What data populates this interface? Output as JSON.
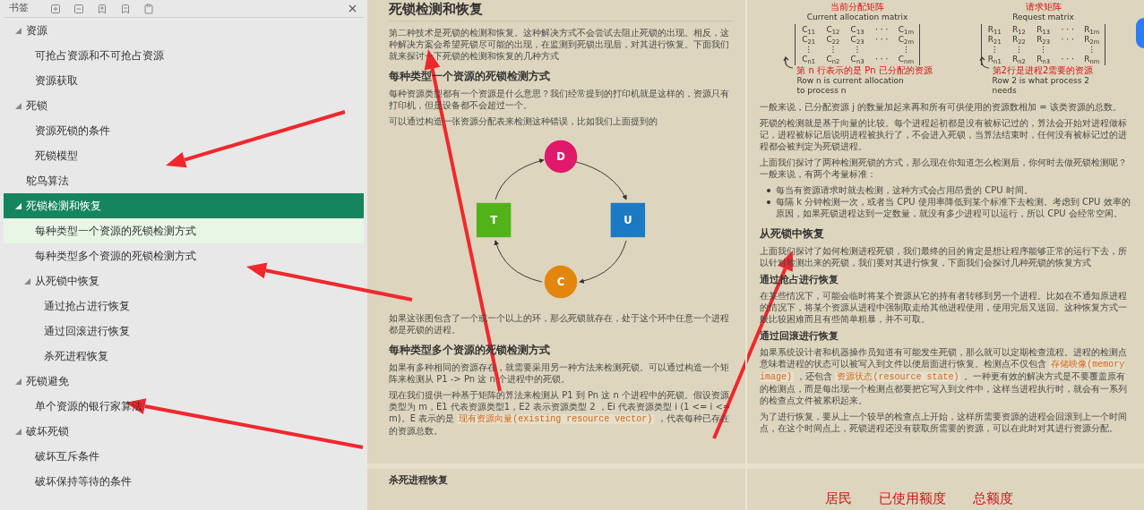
{
  "sidebar": {
    "title": "书签",
    "items": [
      {
        "label": "资源",
        "expanded": true,
        "selected": false,
        "highlighted": false,
        "children": [
          {
            "label": "可抢占资源和不可抢占资源",
            "selected": false,
            "highlighted": false
          },
          {
            "label": "资源获取",
            "selected": false,
            "highlighted": false
          }
        ]
      },
      {
        "label": "死锁",
        "expanded": true,
        "selected": false,
        "highlighted": false,
        "children": [
          {
            "label": "资源死锁的条件",
            "selected": false,
            "highlighted": false
          },
          {
            "label": "死锁模型",
            "selected": false,
            "highlighted": false
          }
        ]
      },
      {
        "label": "鸵鸟算法",
        "selected": false,
        "highlighted": false
      },
      {
        "label": "死锁检测和恢复",
        "expanded": true,
        "selected": true,
        "highlighted": false,
        "children": [
          {
            "label": "每种类型一个资源的死锁检测方式",
            "selected": false,
            "highlighted": true
          },
          {
            "label": "每种类型多个资源的死锁检测方式",
            "selected": false,
            "highlighted": false
          },
          {
            "label": "从死锁中恢复",
            "expanded": true,
            "selected": false,
            "highlighted": false,
            "children": [
              {
                "label": "通过抢占进行恢复",
                "selected": false,
                "highlighted": false
              },
              {
                "label": "通过回滚进行恢复",
                "selected": false,
                "highlighted": false
              },
              {
                "label": "杀死进程恢复",
                "selected": false,
                "highlighted": false
              }
            ]
          }
        ]
      },
      {
        "label": "死锁避免",
        "expanded": true,
        "selected": false,
        "highlighted": false,
        "children": [
          {
            "label": "单个资源的银行家算法",
            "selected": false,
            "highlighted": false
          }
        ]
      },
      {
        "label": "破坏死锁",
        "expanded": true,
        "selected": false,
        "highlighted": false,
        "children": [
          {
            "label": "破坏互斥条件",
            "selected": false,
            "highlighted": false
          },
          {
            "label": "破坏保持等待的条件",
            "selected": false,
            "highlighted": false
          }
        ]
      }
    ]
  },
  "columns": [
    {
      "pages": [
        {
          "blocks": [
            {
              "kind": "title",
              "text": "死锁检测和恢复"
            },
            {
              "kind": "paragraph",
              "text": "第二种技术是死锁的检测和恢复。这种解决方式不会尝试去阻止死锁的出现。相反，这种解决方案会希望死锁尽可能的出现，在监测到死锁出现后，对其进行恢复。下面我们就来探讨一下死锁的检测和恢复的几种方式"
            },
            {
              "kind": "heading",
              "text": "每种类型一个资源的死锁检测方式"
            },
            {
              "kind": "paragraph",
              "text": "每种资源类型都有一个资源是什么意思？我们经常提到的打印机就是这样的，资源只有打印机，但是设备都不会超过一个。"
            },
            {
              "kind": "paragraph",
              "text": "可以通过构造一张资源分配表来检测这种错误，比如我们上面提到的"
            },
            {
              "kind": "graph",
              "nodes": [
                {
                  "label": "D",
                  "kind": "circle",
                  "color": "#e0196a"
                },
                {
                  "label": "U",
                  "kind": "square",
                  "color": "#1c7ac4"
                },
                {
                  "label": "C",
                  "kind": "circle",
                  "color": "#e2860c"
                },
                {
                  "label": "T",
                  "kind": "square",
                  "color": "#52b21a"
                }
              ]
            },
            {
              "kind": "paragraph",
              "text": "如果这张图包含了一个或一个以上的环，那么死锁就存在，处于这个环中任意一个进程都是死锁的进程。"
            },
            {
              "kind": "heading",
              "text": "每种类型多个资源的死锁检测方式"
            },
            {
              "kind": "paragraph",
              "text": "如果有多种相同的资源存在，就需要采用另一种方法来检测死锁。可以通过构造一个矩阵来检测从 P1 -> Pn 这 n 个进程中的死锁。"
            },
            {
              "kind": "rich_paragraph",
              "parts": [
                {
                  "kind": "text",
                  "text": "现在我们提供一种基于矩阵的算法来检测从 P1 到 Pn 这 n 个进程中的死锁。假设资源类型为 m，E1 代表资源类型1，E2 表示资源类型 2 ，Ei 代表资源类型 i (1 <= i <= m)。E 表示的是 "
                },
                {
                  "kind": "code",
                  "text": "现有资源向量(existing resource vector)"
                },
                {
                  "kind": "text",
                  "text": " ，代表每种已存在的资源总数。"
                }
              ]
            }
          ]
        },
        {
          "blocks": [
            {
              "kind": "subheading",
              "text": "杀死进程恢复"
            }
          ]
        }
      ]
    },
    {
      "pages": [
        {
          "blocks": [
            {
              "kind": "matrices",
              "items": [
                {
                  "caption_cn": "当前分配矩阵",
                  "caption_en": "Current allocation matrix",
                  "rows": [
                    [
                      "C$_{11}$",
                      "C$_{12}$",
                      "C$_{13}$",
                      "· · ·",
                      "C$_{1m}$"
                    ],
                    [
                      "C$_{21}$",
                      "C$_{22}$",
                      "C$_{23}$",
                      "· · ·",
                      "C$_{2m}$"
                    ],
                    [
                      "⋮",
                      "⋮",
                      "⋮",
                      "",
                      "⋮"
                    ],
                    [
                      "C$_{n1}$",
                      "C$_{n2}$",
                      "C$_{n3}$",
                      "· · ·",
                      "C$_{nm}$"
                    ]
                  ],
                  "note_cn": "第 n 行表示的是 Pn 已分配的资源",
                  "note_en": "Row n is current allocation to process n"
                },
                {
                  "caption_cn": "请求矩阵",
                  "caption_en": "Request matrix",
                  "rows": [
                    [
                      "R$_{11}$",
                      "R$_{12}$",
                      "R$_{13}$",
                      "· · ·",
                      "R$_{1m}$"
                    ],
                    [
                      "R$_{21}$",
                      "R$_{22}$",
                      "R$_{23}$",
                      "· · ·",
                      "R$_{2m}$"
                    ],
                    [
                      "⋮",
                      "⋮",
                      "⋮",
                      "",
                      "⋮"
                    ],
                    [
                      "R$_{n1}$",
                      "R$_{n2}$",
                      "R$_{n3}$",
                      "· · ·",
                      "R$_{nm}$"
                    ]
                  ],
                  "note_cn": "第2行是进程2需要的资源",
                  "note_en": "Row 2 is what process 2 needs"
                }
              ]
            },
            {
              "kind": "paragraph",
              "text": "一般来说，已分配资源 j 的数量加起来再和所有可供使用的资源数相加 = 该类资源的总数。"
            },
            {
              "kind": "paragraph",
              "text": "死锁的检测就是基于向量的比较。每个进程起初都是没有被标记过的，算法会开始对进程做标记，进程被标记后说明进程被执行了，不会进入死锁，当算法结束时，任何没有被标记过的进程都会被判定为死锁进程。"
            },
            {
              "kind": "paragraph",
              "text": "上面我们探讨了两种检测死锁的方式，那么现在你知道怎么检测后，你何时去做死锁检测呢？一般来说，有两个考量标准："
            },
            {
              "kind": "bullets",
              "items": [
                "每当有资源请求时就去检测，这种方式会占用昂贵的 CPU 时间。",
                "每隔 k 分钟检测一次，或者当 CPU 使用率降低到某个标准下去检测。考虑到 CPU 效率的原因，如果死锁进程达到一定数量，就没有多少进程可以运行，所以 CPU 会经常空闲。"
              ]
            },
            {
              "kind": "heading",
              "text": "从死锁中恢复"
            },
            {
              "kind": "paragraph",
              "text": "上面我们探讨了如何检测进程死锁，我们最终的目的肯定是想让程序能够正常的运行下去，所以针对检测出来的死锁，我们要对其进行恢复，下面我们会探讨几种死锁的恢复方式"
            },
            {
              "kind": "subheading",
              "text": "通过抢占进行恢复"
            },
            {
              "kind": "paragraph",
              "text": "在某些情况下，可能会临时将某个资源从它的持有者转移到另一个进程。比如在不通知原进程的情况下，将某个资源从进程中强制取走给其他进程使用，使用完后又送回。这种恢复方式一般比较困难而且有些简单粗暴，并不可取。"
            },
            {
              "kind": "subheading",
              "text": "通过回滚进行恢复"
            },
            {
              "kind": "rich_paragraph",
              "parts": [
                {
                  "kind": "text",
                  "text": "如果系统设计者和机器操作员知道有可能发生死锁，那么就可以定期检查流程。进程的检测点意味着进程的状态可以被写入到文件以便后面进行恢复。检测点不仅包含 "
                },
                {
                  "kind": "code",
                  "text": "存储映像(memory image)"
                },
                {
                  "kind": "text",
                  "text": " ，还包含 "
                },
                {
                  "kind": "code",
                  "text": "资源状态(resource state)"
                },
                {
                  "kind": "text",
                  "text": " 。一种更有效的解决方式是不要覆盖原有的检测点，而是每出现一个检测点都要把它写入到文件中，这样当进程执行时，就会有一系列的检查点文件被累积起来。"
                }
              ]
            },
            {
              "kind": "paragraph",
              "text": "为了进行恢复，要从上一个较早的检查点上开始，这样所需要资源的进程会回滚到上一个时间点，在这个时间点上，死锁进程还没有获取所需要的资源，可以在此时对其进行资源分配。"
            }
          ]
        },
        {
          "blocks": [
            {
              "kind": "red_labels",
              "items": [
                "居民",
                "已使用额度",
                "总额度"
              ]
            }
          ]
        }
      ]
    }
  ]
}
